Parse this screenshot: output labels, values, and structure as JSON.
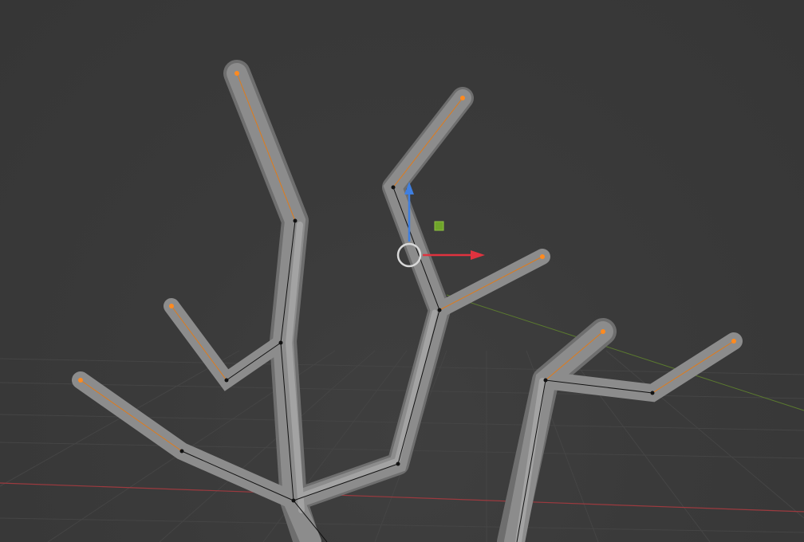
{
  "viewport": {
    "mode": "edit",
    "selected_vertex_color": "#ff8a1f",
    "vertex_color": "#111111",
    "mesh_color": "#8c8c8c",
    "background_color": "#393939",
    "axis_x_color": "#9c3a3f",
    "axis_y_color": "#5b7a2f"
  },
  "gizmo": {
    "z_arrow_color": "#3f7fe0",
    "x_arrow_color": "#e0333f",
    "xz_plane_handle_color": "#6fa52a",
    "pivot_ring_color": "#d8d8d8"
  }
}
